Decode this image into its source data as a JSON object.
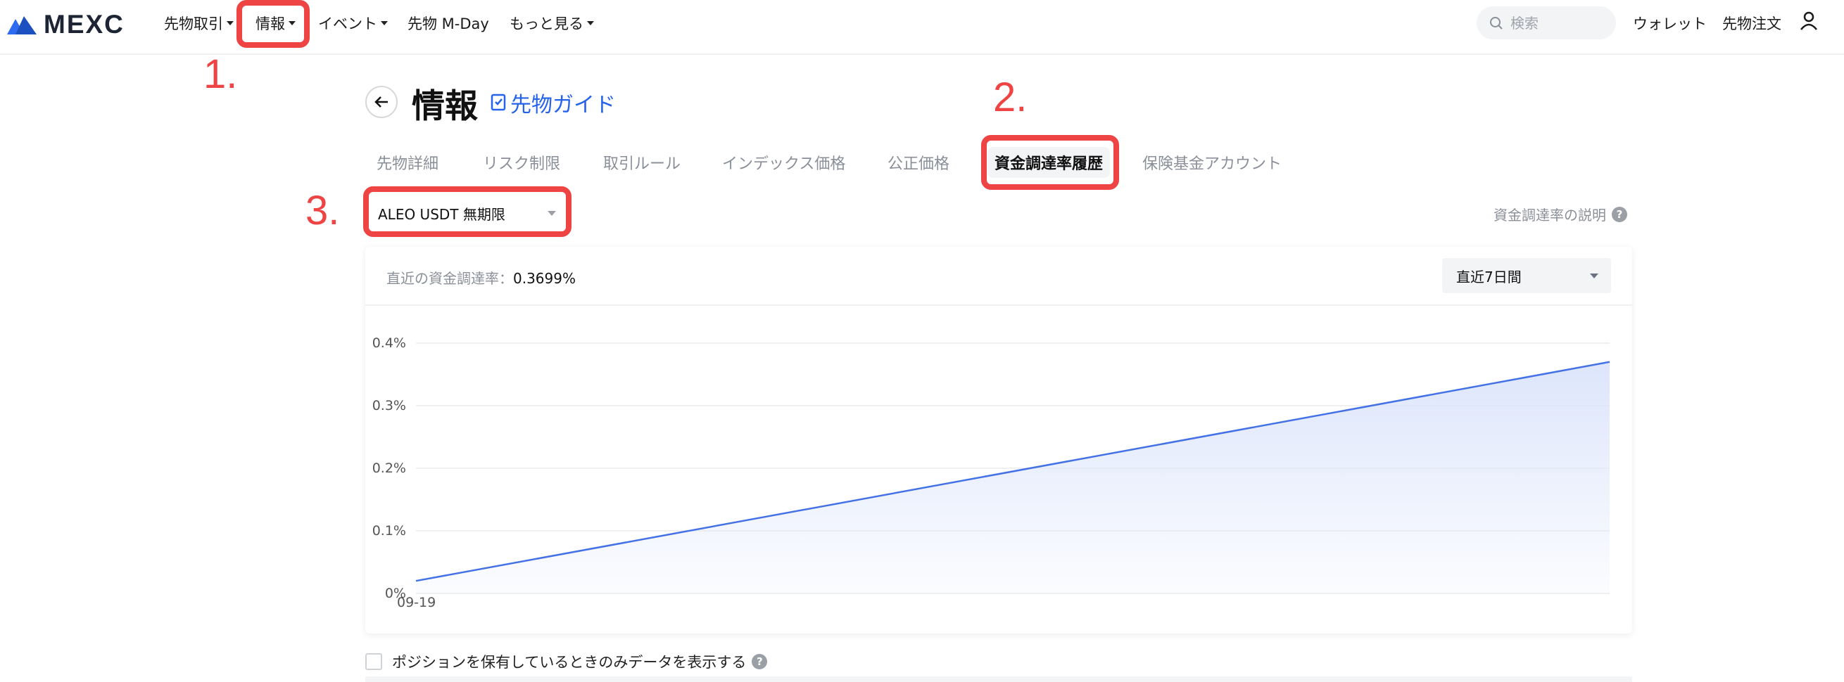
{
  "nav": {
    "logo_text": "MEXC",
    "items": [
      {
        "label": "先物取引"
      },
      {
        "label": "情報"
      },
      {
        "label": "イベント"
      },
      {
        "label": "先物 M-Day"
      },
      {
        "label": "もっと見る"
      }
    ],
    "search_placeholder": "検索",
    "wallet": "ウォレット",
    "futures_orders": "先物注文",
    "icons": [
      "search-icon",
      "user-icon"
    ]
  },
  "annotations": {
    "step1": "1.",
    "step2": "2.",
    "step3": "3.",
    "color": "#ef4444"
  },
  "page": {
    "title": "情報",
    "guide_link": "先物ガイド",
    "tabs": [
      {
        "label": "先物詳細"
      },
      {
        "label": "リスク制限"
      },
      {
        "label": "取引ルール"
      },
      {
        "label": "インデックス価格"
      },
      {
        "label": "公正価格"
      },
      {
        "label": "資金調達率履歴",
        "active": true
      },
      {
        "label": "保険基金アカウント"
      }
    ],
    "contract_selected": "ALEO USDT 無期限",
    "funding_explain": "資金調達率の説明"
  },
  "card": {
    "recent_rate_label": "直近の資金調達率：",
    "recent_rate_value": "0.3699%",
    "period_selected": "直近7日間"
  },
  "chart_data": {
    "type": "area",
    "x": [
      "09-19"
    ],
    "series": [
      {
        "values_x_frac": [
          0,
          1
        ],
        "values": [
          0.02,
          0.3699
        ]
      }
    ],
    "yticks": [
      "0%",
      "0.1%",
      "0.2%",
      "0.3%",
      "0.4%"
    ],
    "ylim": [
      0,
      0.4
    ],
    "xtick_labels": [
      "09-19"
    ],
    "line_color": "#4472e6",
    "fill_color": "#dbe4fb",
    "grid": true
  },
  "footer": {
    "checkbox_label": "ポジションを保有しているときのみデータを表示する"
  }
}
